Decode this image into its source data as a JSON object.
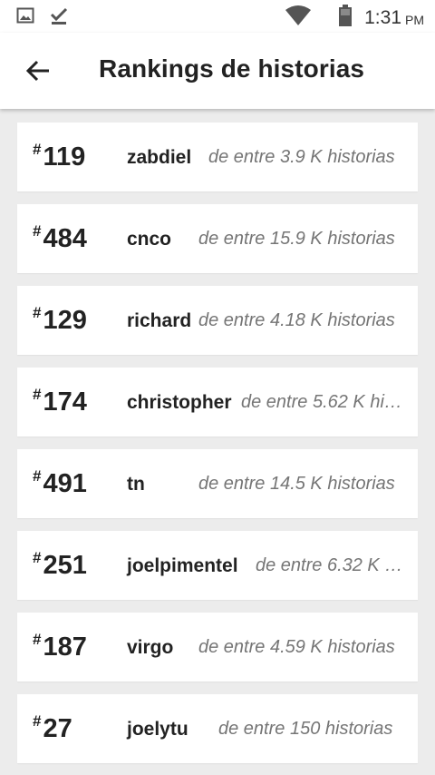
{
  "status_bar": {
    "time": "1:31",
    "ampm": "PM",
    "icons": [
      "image-icon",
      "download-done-icon",
      "wifi-icon",
      "battery-icon"
    ]
  },
  "header": {
    "back_icon": "arrow-left-icon",
    "title": "Rankings de historias"
  },
  "rankings": [
    {
      "hash": "#",
      "rank": "119",
      "tag": "zabdiel",
      "count": "de entre 3.9 K historias"
    },
    {
      "hash": "#",
      "rank": "484",
      "tag": "cnco",
      "count": "de entre 15.9 K historias"
    },
    {
      "hash": "#",
      "rank": "129",
      "tag": "richard",
      "count": "de entre 4.18 K historias"
    },
    {
      "hash": "#",
      "rank": "174",
      "tag": "christopher",
      "count": "de entre 5.62 K hi…"
    },
    {
      "hash": "#",
      "rank": "491",
      "tag": "tn",
      "count": "de entre 14.5 K historias"
    },
    {
      "hash": "#",
      "rank": "251",
      "tag": "joelpimentel",
      "count": "de entre 6.32 K …"
    },
    {
      "hash": "#",
      "rank": "187",
      "tag": "virgo",
      "count": "de entre 4.59 K historias"
    },
    {
      "hash": "#",
      "rank": "27",
      "tag": "joelytu",
      "count": "de entre 150 historias"
    }
  ],
  "colors": {
    "background": "#ececec",
    "card": "#ffffff",
    "text_primary": "#222222",
    "text_secondary": "#757575"
  }
}
